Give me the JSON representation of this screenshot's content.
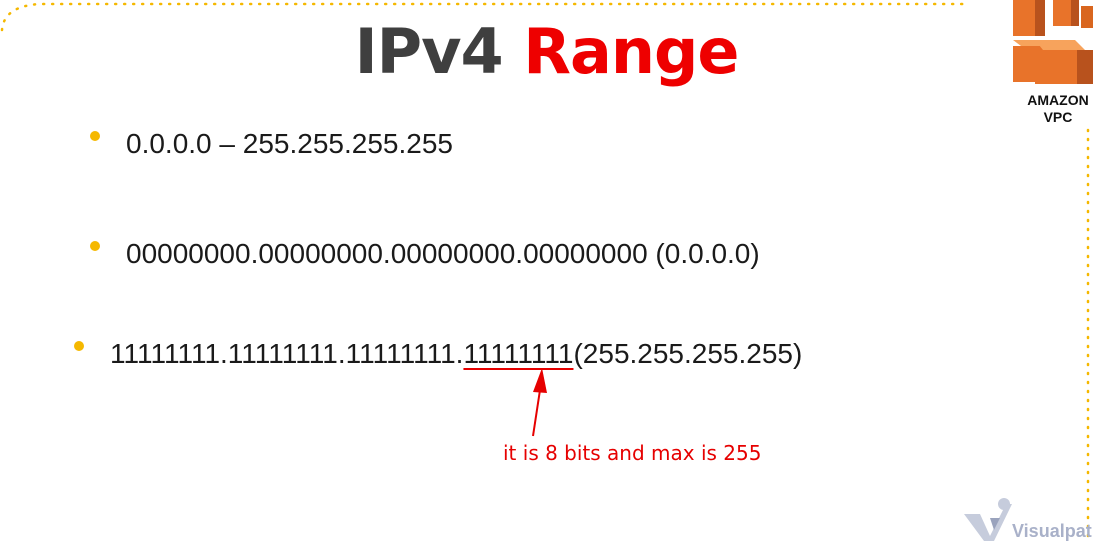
{
  "slide": {
    "title_part1": "IPv4",
    "title_part2": "Range",
    "title_colors": {
      "part1": "#3f3f3f",
      "part2": "#ee0000"
    },
    "bullet_color": "#f5b800",
    "bullets": [
      {
        "text": "0.0.0.0 – 255.255.255.255"
      },
      {
        "text": "00000000.00000000.00000000.00000000 (0.0.0.0)"
      },
      {
        "prefix": "11111111.11111111.11111111.",
        "underlined": "11111111 ",
        "suffix": "(255.255.255.255)"
      }
    ],
    "annotation": "it is 8 bits and max is 255",
    "annotation_color": "#e60000"
  },
  "logos": {
    "aws_vpc": {
      "line1": "AMAZON",
      "line2": "VPC",
      "icon": "amazon-vpc-icon"
    },
    "visualpath": {
      "text": "Visualpath",
      "icon": "visualpath-logo-icon"
    }
  }
}
